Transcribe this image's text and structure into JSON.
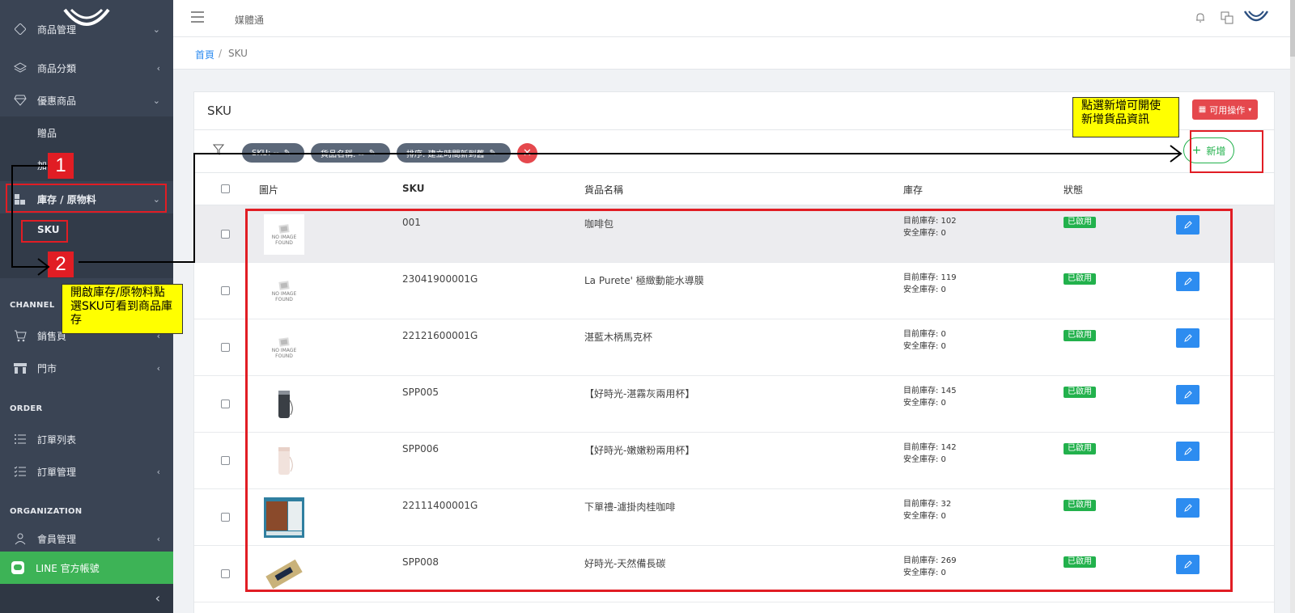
{
  "app": {
    "title": "媒體通"
  },
  "sidebar": {
    "items": [
      {
        "label": "商品管理",
        "icon": "tag-icon"
      },
      {
        "label": "商品分類",
        "icon": "layers-icon"
      },
      {
        "label": "優惠商品",
        "icon": "diamond-icon"
      },
      {
        "label": "贈品"
      },
      {
        "label": "加"
      },
      {
        "label": "庫存 / 原物料",
        "icon": "boxes-icon"
      },
      {
        "label": "SKU"
      },
      {
        "label": "銷售頁",
        "icon": "cart-icon"
      },
      {
        "label": "門市",
        "icon": "store-icon"
      },
      {
        "label": "訂單列表",
        "icon": "list-icon"
      },
      {
        "label": "訂單管理",
        "icon": "checklist-icon"
      },
      {
        "label": "會員管理",
        "icon": "user-icon"
      }
    ],
    "sections": {
      "channel": "CHANNEL",
      "order": "ORDER",
      "organization": "ORGANIZATION"
    },
    "line_account": "LINE 官方帳號"
  },
  "breadcrumb": {
    "home": "首頁",
    "sep": "/",
    "current": "SKU"
  },
  "card": {
    "title": "SKU",
    "actions_label": "可用操作",
    "add_label": "新增"
  },
  "filters": [
    {
      "label": "SKU: --"
    },
    {
      "label": "貨品名稱: --"
    },
    {
      "label": "排序: 建立時間新到舊"
    }
  ],
  "table": {
    "headers": {
      "image": "圖片",
      "sku": "SKU",
      "name": "貨品名稱",
      "stock": "庫存",
      "status": "狀態"
    },
    "no_image_text": [
      "NO IMAGE",
      "FOUND"
    ],
    "rows": [
      {
        "sku": "001",
        "name": "咖啡包",
        "current": "目前庫存: 102",
        "safety": "安全庫存: 0",
        "status": "已啟用",
        "img": "noimage"
      },
      {
        "sku": "23041900001G",
        "name": "La Purete' 極緻動能水導膜",
        "current": "目前庫存: 119",
        "safety": "安全庫存: 0",
        "status": "已啟用",
        "img": "noimage"
      },
      {
        "sku": "22121600001G",
        "name": "湛藍木柄馬克杯",
        "current": "目前庫存: 0",
        "safety": "安全庫存: 0",
        "status": "已啟用",
        "img": "noimage"
      },
      {
        "sku": "SPP005",
        "name": "【好時光-湛霧灰兩用杯】",
        "current": "目前庫存: 145",
        "safety": "安全庫存: 0",
        "status": "已啟用",
        "img": "darkcup"
      },
      {
        "sku": "SPP006",
        "name": "【好時光-嫩嫩粉兩用杯】",
        "current": "目前庫存: 142",
        "safety": "安全庫存: 0",
        "status": "已啟用",
        "img": "pinkcup"
      },
      {
        "sku": "22111400001G",
        "name": "下單禮-濾掛肉桂咖啡",
        "current": "目前庫存: 32",
        "safety": "安全庫存: 0",
        "status": "已啟用",
        "img": "coffee"
      },
      {
        "sku": "SPP008",
        "name": "好時光-天然備長碳",
        "current": "目前庫存: 269",
        "safety": "安全庫存: 0",
        "status": "已啟用",
        "img": "charcoal"
      }
    ]
  },
  "annotations": {
    "step1": "1",
    "step2": "2",
    "note_left": "開啟庫存/原物料點選SKU可看到商品庫存",
    "note_right": "點選新增可開使新增貨品資訊"
  },
  "colors": {
    "sidebar": "#3a4454",
    "accent_blue": "#2d8cf0",
    "status_green": "#22b14c",
    "danger": "#e5484d",
    "annotation_red": "#e11d24",
    "line_green": "#3db356"
  }
}
